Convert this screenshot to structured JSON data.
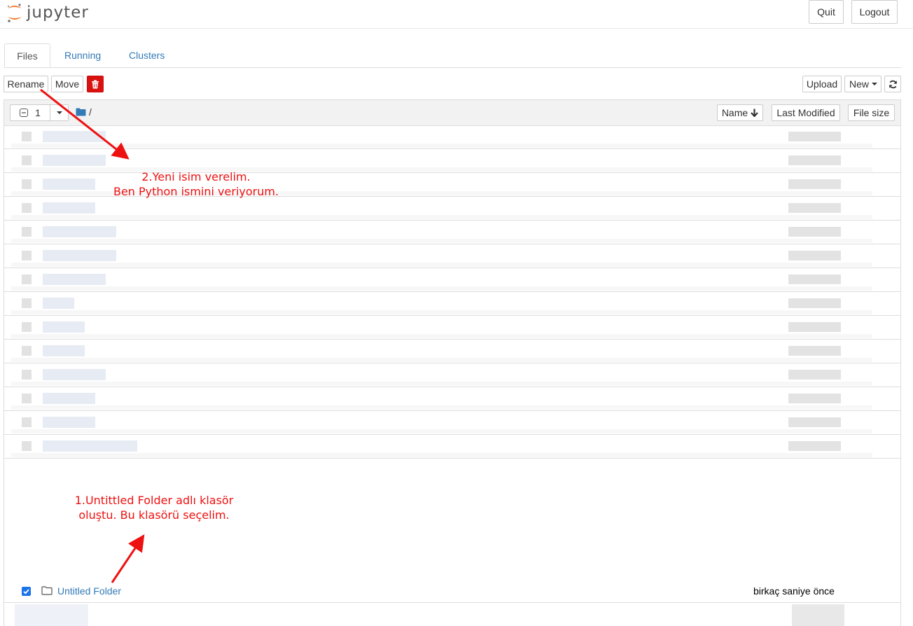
{
  "header": {
    "logo_text": "jupyter",
    "quit_label": "Quit",
    "logout_label": "Logout"
  },
  "tabs": [
    {
      "label": "Files"
    },
    {
      "label": "Running"
    },
    {
      "label": "Clusters"
    }
  ],
  "toolbar": {
    "rename_label": "Rename",
    "move_label": "Move",
    "upload_label": "Upload",
    "new_label": "New"
  },
  "list_header": {
    "selected_count": "1",
    "path": "/",
    "sort_name_label": "Name",
    "last_modified_label": "Last Modified",
    "file_size_label": "File size"
  },
  "selected_item": {
    "name": "Untitled Folder",
    "modified": "birkaç saniye önce",
    "checked": true
  },
  "annotations": {
    "step2_line1": "2.Yeni isim verelim.",
    "step2_line2": "Ben Python ismini veriyorum.",
    "step1_line1": "1.Untittled Folder adlı klasör",
    "step1_line2": "oluştu. Bu klasörü seçelim."
  },
  "colors": {
    "link": "#337ab7",
    "danger": "#d9110f",
    "annotation": "#ee1111",
    "logo_orange": "#f37726"
  }
}
